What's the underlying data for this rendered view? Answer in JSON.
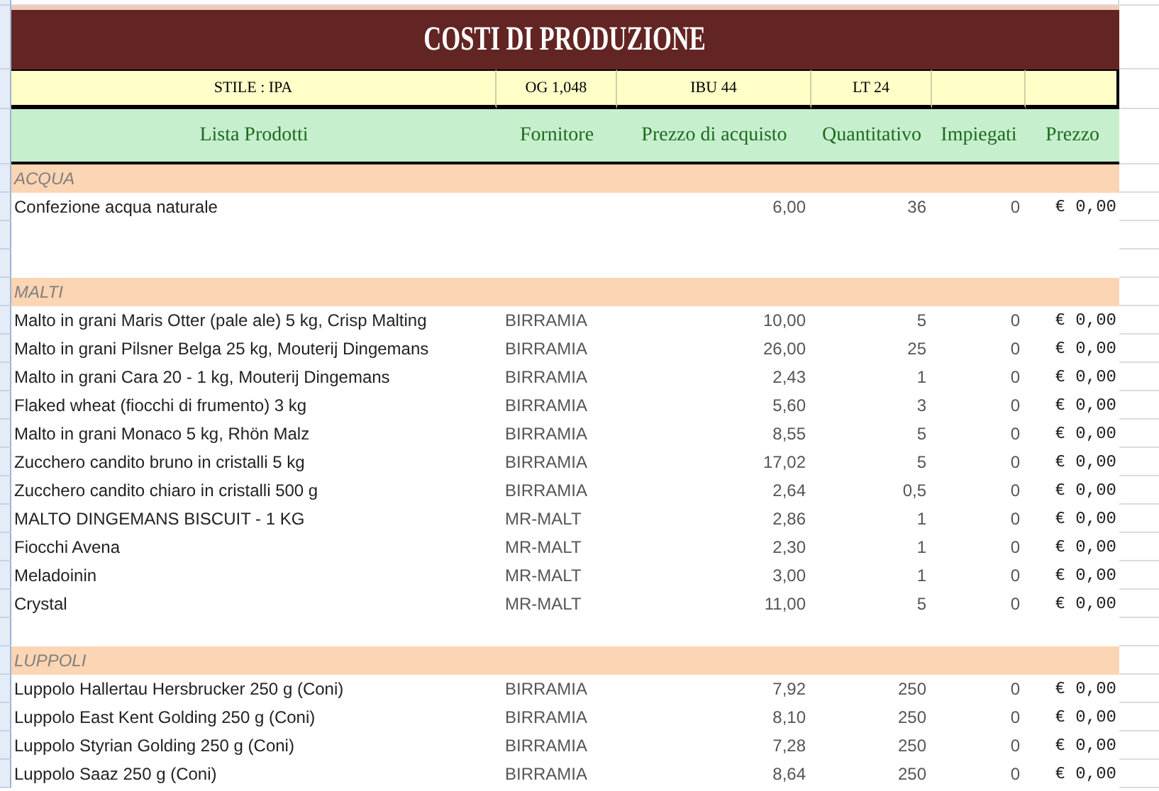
{
  "title": "COSTI DI PRODUZIONE",
  "info": [
    "STILE : IPA",
    "OG 1,048",
    "IBU 44",
    "LT 24"
  ],
  "columns": [
    "Lista Prodotti",
    "Fornitore",
    "Prezzo di acquisto",
    "Quantitativo",
    "Impiegati",
    "Prezzo"
  ],
  "sections": [
    {
      "name": "ACQUA",
      "rows": [
        {
          "kind": "item",
          "product": "Confezione acqua naturale",
          "price": "6,00",
          "quantity": "36",
          "used": "0",
          "total": "€ 0,00"
        },
        {
          "kind": "blank"
        },
        {
          "kind": "blank"
        }
      ]
    },
    {
      "name": "MALTI",
      "rows": [
        {
          "kind": "item",
          "product": "Malto in grani Maris Otter (pale ale) 5 kg, Crisp Malting",
          "supplier": "BIRRAMIA",
          "price": "10,00",
          "quantity": "5",
          "used": "0",
          "total": "€ 0,00"
        },
        {
          "kind": "item",
          "product": "Malto in grani Pilsner Belga 25 kg, Mouterij Dingemans",
          "supplier": "BIRRAMIA",
          "price": "26,00",
          "quantity": "25",
          "used": "0",
          "total": "€ 0,00"
        },
        {
          "kind": "item",
          "product": "Malto in grani Cara 20 - 1 kg, Mouterij Dingemans",
          "supplier": "BIRRAMIA",
          "price": "2,43",
          "quantity": "1",
          "used": "0",
          "total": "€ 0,00"
        },
        {
          "kind": "item",
          "product": "Flaked wheat (fiocchi di frumento) 3 kg",
          "supplier": "BIRRAMIA",
          "price": "5,60",
          "quantity": "3",
          "used": "0",
          "total": "€ 0,00"
        },
        {
          "kind": "item",
          "product": "Malto in grani Monaco 5 kg, Rhön Malz",
          "supplier": "BIRRAMIA",
          "price": "8,55",
          "quantity": "5",
          "used": "0",
          "total": "€ 0,00"
        },
        {
          "kind": "item",
          "product": "Zucchero candito bruno in cristalli 5 kg",
          "supplier": "BIRRAMIA",
          "price": "17,02",
          "quantity": "5",
          "used": "0",
          "total": "€ 0,00"
        },
        {
          "kind": "item",
          "product": "Zucchero candito chiaro in cristalli 500 g",
          "supplier": "BIRRAMIA",
          "price": "2,64",
          "quantity": "0,5",
          "used": "0",
          "total": "€ 0,00"
        },
        {
          "kind": "item",
          "product": "MALTO DINGEMANS BISCUIT - 1 KG",
          "supplier": "MR-MALT",
          "price": "2,86",
          "quantity": "1",
          "used": "0",
          "total": "€ 0,00"
        },
        {
          "kind": "item",
          "product": "Fiocchi Avena",
          "supplier": "MR-MALT",
          "price": "2,30",
          "quantity": "1",
          "used": "0",
          "total": "€ 0,00"
        },
        {
          "kind": "item",
          "product": "Meladoinin",
          "supplier": "MR-MALT",
          "price": "3,00",
          "quantity": "1",
          "used": "0",
          "total": "€ 0,00"
        },
        {
          "kind": "item",
          "product": "Crystal",
          "supplier": "MR-MALT",
          "price": "11,00",
          "quantity": "5",
          "used": "0",
          "total": "€ 0,00"
        },
        {
          "kind": "blank"
        }
      ]
    },
    {
      "name": "LUPPOLI",
      "rows": [
        {
          "kind": "item",
          "product": "Luppolo Hallertau Hersbrucker 250 g (Coni)",
          "supplier": "BIRRAMIA",
          "price": "7,92",
          "quantity": "250",
          "used": "0",
          "total": "€ 0,00"
        },
        {
          "kind": "item",
          "product": "Luppolo East Kent Golding 250 g (Coni)",
          "supplier": "BIRRAMIA",
          "price": "8,10",
          "quantity": "250",
          "used": "0",
          "total": "€ 0,00"
        },
        {
          "kind": "item",
          "product": "Luppolo Styrian Golding 250 g (Coni)",
          "supplier": "BIRRAMIA",
          "price": "7,28",
          "quantity": "250",
          "used": "0",
          "total": "€ 0,00"
        },
        {
          "kind": "item",
          "product": "Luppolo Saaz 250 g (Coni)",
          "supplier": "BIRRAMIA",
          "price": "8,64",
          "quantity": "250",
          "used": "0",
          "total": "€ 0,00"
        }
      ]
    }
  ]
}
